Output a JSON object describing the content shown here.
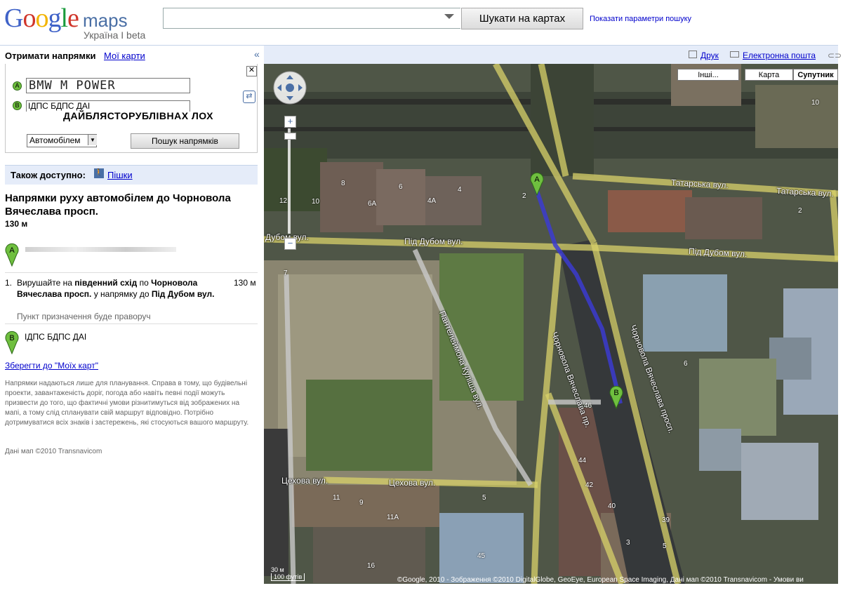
{
  "header": {
    "logo_google": "Google",
    "logo_maps": "maps",
    "logo_sub": "Україна І beta",
    "search_value": "",
    "search_button": "Шукати на картах",
    "show_options": "Показати параметри пошуку"
  },
  "tabs": {
    "directions": "Отримати напрямки",
    "my_maps": "Мої карти",
    "collapse": "«"
  },
  "form": {
    "from_label": "A",
    "from_value": "BMW M POWER",
    "to_label": "B",
    "to_value": "ІДПС БДПС ДАІ",
    "overlay_text": "ДАЙБЛЯСТОРУБЛІВНАХ ЛОХ",
    "mode": "Автомобілем",
    "route_button": "Пошук напрямків"
  },
  "also": {
    "label": "Також доступно:",
    "walk": "Пішки"
  },
  "directions": {
    "title": "Напрямки руху автомобілем до Чорновола Вячеслава просп.",
    "distance": "130 м",
    "step1_num": "1.",
    "step1_text_pre": "Вирушайте на ",
    "step1_dir": "південний схід",
    "step1_mid": " по ",
    "step1_street": "Чорновола Вячеслава просп.",
    "step1_toward": " у напрямку до ",
    "step1_cross": "Під Дубом вул.",
    "step1_dist": "130 м",
    "step1_note": "Пункт призначення буде праворуч",
    "end_text": "ІДПС БДПС ДАІ",
    "save": "Зберегти до \"Моїх карт\"",
    "disclaimer": "Напрямки надаються лише для планування. Справа в тому, що будівельні проекти, завантаженість доріг, погода або навіть певні події можуть призвести до того, що фактичні умови різнитимуться від зображених на мапі, а тому слід спланувати свій маршрут відповідно. Потрібно дотримуватися всіх знаків і застережень, які стосуються вашого маршруту.",
    "map_data": "Дані мап ©2010 Transnavicom"
  },
  "map_toolbar": {
    "print": "Друк",
    "email": "Електронна пошта"
  },
  "map": {
    "btn_other": "Інші...",
    "btn_map": "Карта",
    "btn_satellite": "Супутник",
    "copyright": "©Google, 2010 - Зображення ©2010 DigitalGlobe, GeoEye, European Space Imaging, Дані мап ©2010 Transnavicom - Умови ви",
    "scale_m": "30 м",
    "scale_ft": "100 футів",
    "streets": {
      "tatarska1": "Татарська вул.",
      "tatarska2": "Татарська вул.",
      "pid_dubom1": "Дубом вул.",
      "pid_dubom2": "Під Дубом вул.",
      "pid_dubom3": "Під Дубом вул.",
      "chornovola1": "Чорновола Вячеслава пр.",
      "chornovola2": "Чорновола Вячеслава просп.",
      "kulisha": "Пантелеймона Куліша вул.",
      "tsehova1": "Цехова вул.",
      "tsehova2": "Цехова вул."
    },
    "houses": [
      "10",
      "8",
      "6",
      "4",
      "6А",
      "4А",
      "12",
      "10",
      "2",
      "2",
      "7",
      "6",
      "46",
      "44",
      "42",
      "40",
      "39",
      "11",
      "9",
      "11А",
      "5",
      "45",
      "16",
      "3",
      "5"
    ]
  },
  "colors": {
    "road": "#d8d26a",
    "route": "#3b3bd0",
    "panel_bg": "#e5ecf9",
    "link": "#0000cc",
    "marker": "#6fbf3f"
  }
}
